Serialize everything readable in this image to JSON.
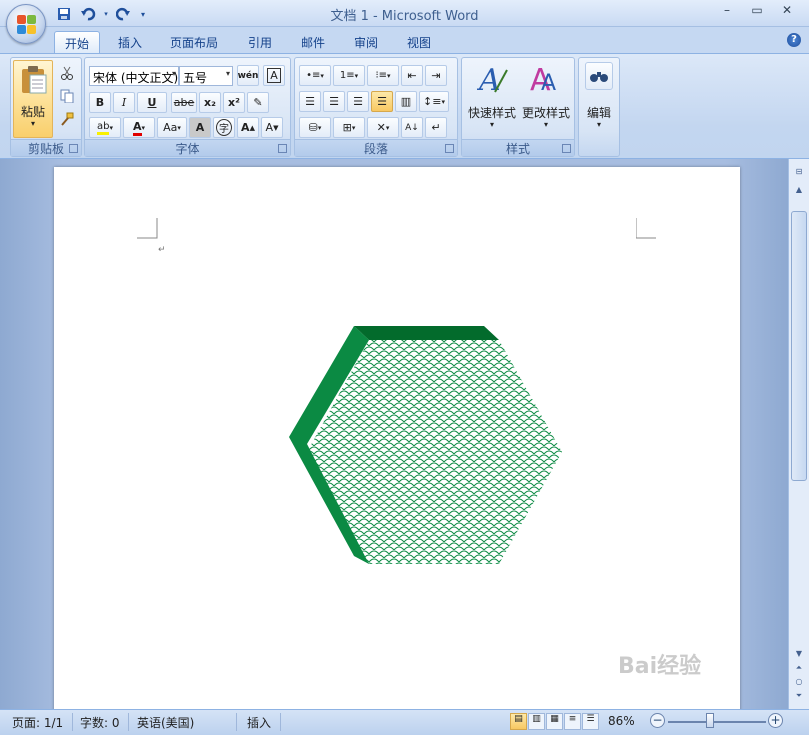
{
  "window": {
    "title": "文档 1 - Microsoft Word",
    "minimize": "–",
    "maximize": "▭",
    "close": "✕"
  },
  "quick_access": [
    "save",
    "undo",
    "redo",
    "customize"
  ],
  "tabs": [
    {
      "label": "开始",
      "active": true
    },
    {
      "label": "插入"
    },
    {
      "label": "页面布局"
    },
    {
      "label": "引用"
    },
    {
      "label": "邮件"
    },
    {
      "label": "审阅"
    },
    {
      "label": "视图"
    }
  ],
  "ribbon": {
    "clipboard": {
      "label": "剪贴板",
      "paste": "粘贴"
    },
    "font": {
      "label": "字体",
      "font_name": "宋体 (中文正文)",
      "font_size": "五号",
      "bold": "B",
      "italic": "I",
      "underline": "U",
      "strike": "abe",
      "subscript": "x₂",
      "superscript": "x²",
      "change_case": "Aa",
      "grow": "A",
      "shrink": "A"
    },
    "paragraph": {
      "label": "段落"
    },
    "styles": {
      "label": "样式",
      "quick_styles": "快速样式",
      "change_styles": "更改样式"
    },
    "editing": {
      "label": "编辑"
    }
  },
  "document": {
    "shape": "hexagon",
    "shape_fill_color": "#0b8a43",
    "shape_edge_color": "#0b8a43",
    "shape_top_color": "#036b2c",
    "paragraph_mark": "↵"
  },
  "status": {
    "page": "页面: 1/1",
    "words": "字数: 0",
    "language": "英语(美国)",
    "mode": "插入",
    "zoom": "86%"
  },
  "watermark": "Bai经验"
}
